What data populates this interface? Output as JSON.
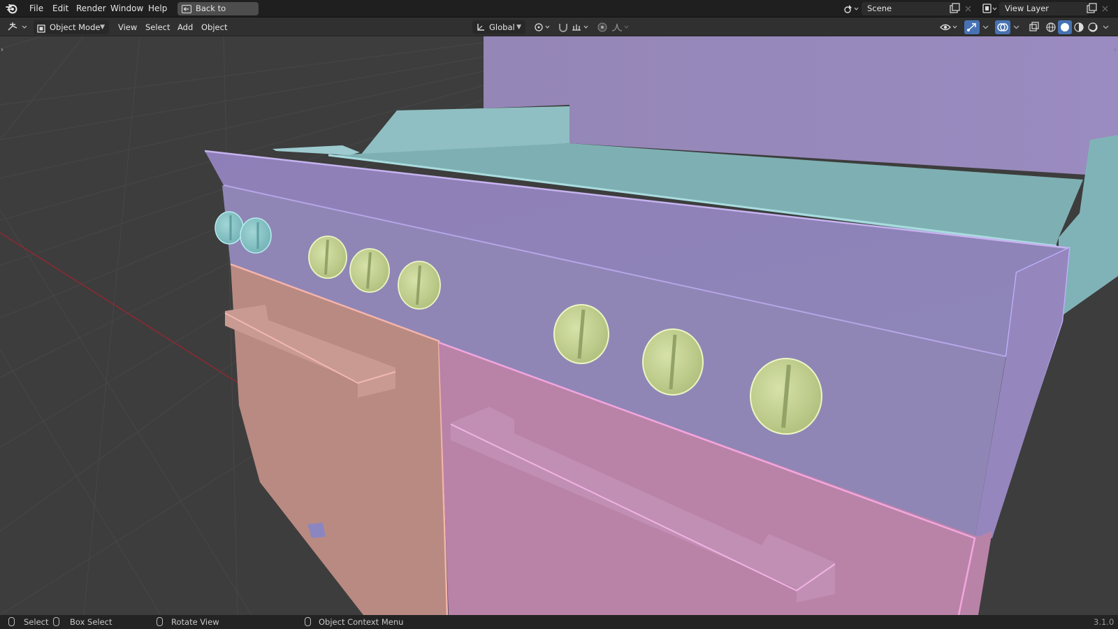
{
  "menubar": {
    "items": [
      "File",
      "Edit",
      "Render",
      "Window",
      "Help"
    ],
    "back_button": "Back to Previous",
    "scene_label": "Scene",
    "view_layer_label": "View Layer"
  },
  "header": {
    "mode": "Object Mode",
    "menus": [
      "View",
      "Select",
      "Add",
      "Object"
    ],
    "orientation": "Global"
  },
  "statusbar": {
    "select": "Select",
    "box_select": "Box Select",
    "rotate_view": "Rotate View",
    "context_menu": "Object Context Menu",
    "version": "3.1.0"
  },
  "colors": {
    "oven_left": "#b98a82",
    "oven_right": "#b983a8",
    "panel_purple": "#9386b5",
    "teal": "#7fb2b6",
    "knob_green": "#c9d69a",
    "viewport_bg": "#3d3d3d",
    "x_axis": "#8a2a33"
  }
}
